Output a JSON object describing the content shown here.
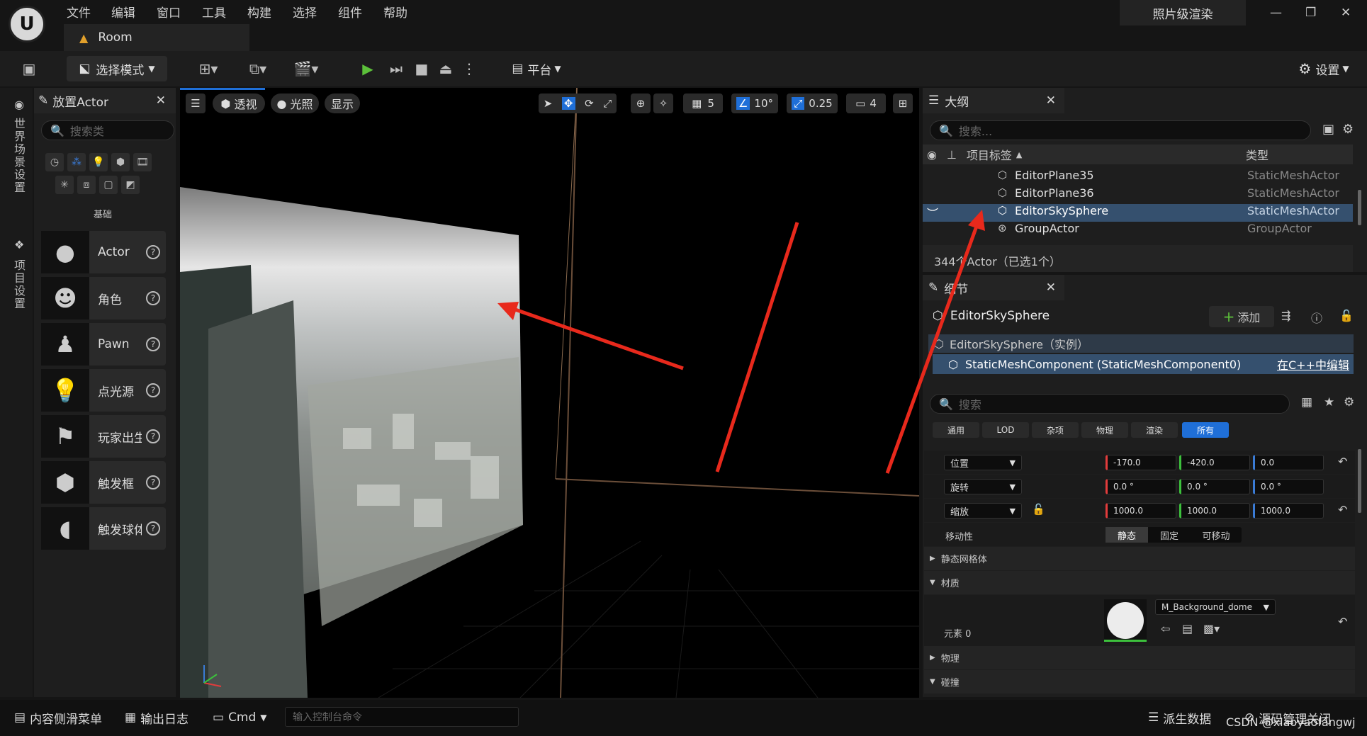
{
  "app": {
    "logo_text": "U",
    "tab_title": "Room",
    "render_mode": "照片级渲染"
  },
  "menu": [
    "文件",
    "编辑",
    "窗口",
    "工具",
    "构建",
    "选择",
    "组件",
    "帮助"
  ],
  "toolbar": {
    "select_mode": "选择模式",
    "platform": "平台",
    "settings": "设置"
  },
  "left_strip": {
    "world_settings": "世界场景设置",
    "project_settings": "项目设置"
  },
  "place_actor": {
    "title": "放置Actor",
    "search_placeholder": "搜索类",
    "category": "基础",
    "items": [
      "Actor",
      "角色",
      "Pawn",
      "点光源",
      "玩家出生点",
      "触发框",
      "触发球体"
    ]
  },
  "viewport": {
    "perspective": "透视",
    "lighting": "光照",
    "show": "显示",
    "grid_size": "5",
    "rot_snap": "10°",
    "scale_snap": "0.25",
    "cam_speed": "4"
  },
  "outliner": {
    "title": "大纲",
    "search_placeholder": "搜索...",
    "col_label": "项目标签",
    "col_type": "类型",
    "rows": [
      {
        "name": "EditorPlane35",
        "type": "StaticMeshActor"
      },
      {
        "name": "EditorPlane36",
        "type": "StaticMeshActor"
      },
      {
        "name": "EditorSkySphere",
        "type": "StaticMeshActor"
      },
      {
        "name": "GroupActor",
        "type": "GroupActor"
      }
    ],
    "footer": "344个Actor（已选1个）"
  },
  "details": {
    "title": "细节",
    "object": "EditorSkySphere",
    "add": "添加",
    "instance": "EditorSkySphere（实例）",
    "component": "StaticMeshComponent (StaticMeshComponent0)",
    "edit_cpp": "在C++中编辑",
    "search_placeholder": "搜索",
    "filters": [
      "通用",
      "LOD",
      "杂项",
      "物理",
      "渲染",
      "所有"
    ],
    "location_label": "位置",
    "rotation_label": "旋转",
    "scale_label": "缩放",
    "location": [
      "-170.0",
      "-420.0",
      "0.0"
    ],
    "rotation": [
      "0.0 °",
      "0.0 °",
      "0.0 °"
    ],
    "scale": [
      "1000.0",
      "1000.0",
      "1000.0"
    ],
    "mobility_label": "移动性",
    "mobility": [
      "静态",
      "固定",
      "可移动"
    ],
    "sections": {
      "static_mesh": "静态网格体",
      "materials": "材质",
      "physics": "物理",
      "collision": "碰撞"
    },
    "element0": "元素 0",
    "material": "M_Background_dome"
  },
  "statusbar": {
    "content_drawer": "内容侧滑菜单",
    "output_log": "输出日志",
    "cmd": "Cmd",
    "console_placeholder": "输入控制台命令",
    "derived_data": "派生数据",
    "source_control": "源码管理关闭",
    "watermark": "CSDN @xiaoyaofangwj"
  }
}
